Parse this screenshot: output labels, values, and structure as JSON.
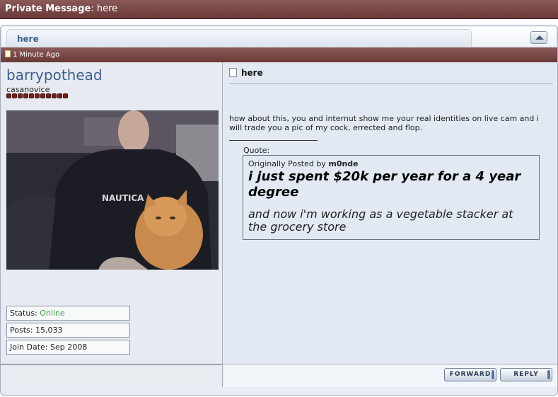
{
  "window": {
    "title_bold": "Private Message",
    "title_rest": ": here"
  },
  "tab": {
    "label": "here"
  },
  "post": {
    "date": "1 Minute Ago"
  },
  "user": {
    "name": "barrypothead",
    "title": "casanovice",
    "status_label": "Status: ",
    "status_value": "Online",
    "posts": "Posts: 15,033",
    "join_date": "Join Date: Sep 2008"
  },
  "message": {
    "title": "here",
    "body": "how about this, you and internut show me your real identities on live cam and i will trade you a pic of my cock, errected and flop.",
    "quote_label": "Quote:",
    "quote_by_prefix": "Originally Posted by ",
    "quote_author": "m0nde",
    "quote_line1": "i just spent $20k per year for a 4 year degree",
    "quote_line2": "and now i'm working as a vegetable stacker at the grocery store"
  },
  "buttons": {
    "forward": "FORWARD",
    "reply": "REPLY"
  },
  "colors": {
    "header_bar": "#7a4846",
    "username": "#3e5f8e",
    "online": "#3aa33a"
  }
}
